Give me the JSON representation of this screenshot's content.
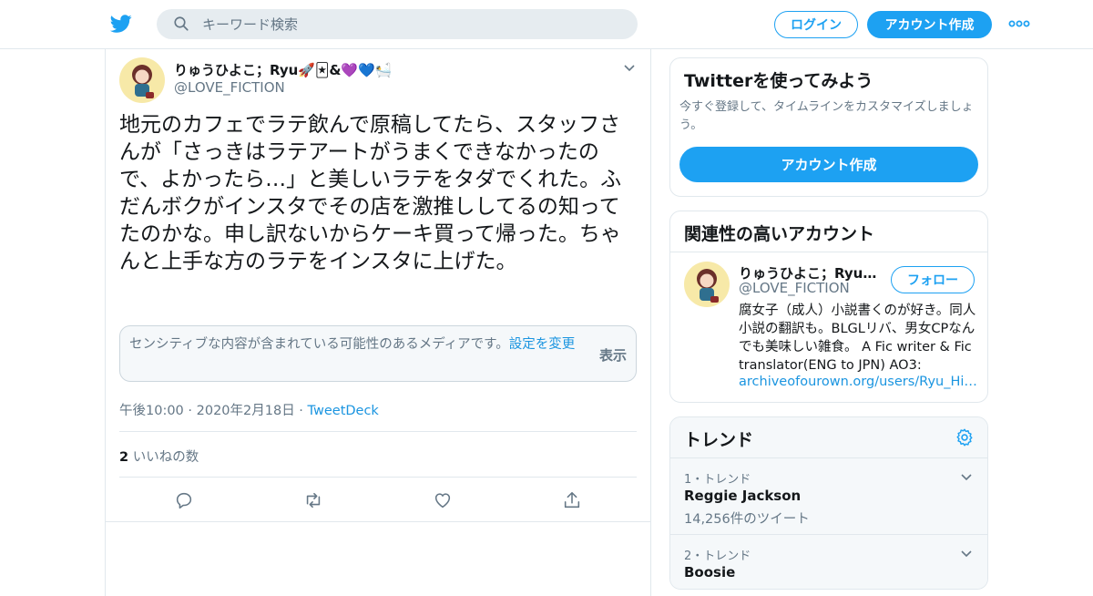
{
  "header": {
    "search_placeholder": "キーワード検索",
    "login_label": "ログイン",
    "signup_label": "アカウント作成"
  },
  "tweet": {
    "display_name": "りゅうひよこ；Ryu🚀🃏&💜💙🛀",
    "handle": "@LOVE_FICTION",
    "text": "地元のカフェでラテ飲んで原稿してたら、スタッフさんが「さっきはラテアートがうまくできなかったので、よかったら…」と美しいラテをタダでくれた。ふだんボクがインスタでその店を激推ししてるの知ってたのかな。申し訳ないからケーキ買って帰った。ちゃんと上手な方のラテをインスタに上げた。",
    "sensitive_text": "センシティブな内容が含まれている可能性のあるメディアです。",
    "sensitive_link": "設定を変更",
    "sensitive_show": "表示",
    "timestamp": "午後10:00 · 2020年2月18日 · ",
    "source": "TweetDeck",
    "likes_count": "2",
    "likes_label": " いいねの数"
  },
  "signup_card": {
    "title": "Twitterを使ってみよう",
    "description": "今すぐ登録して、タイムラインをカスタマイズしましょう。",
    "button_label": "アカウント作成"
  },
  "related": {
    "title": "関連性の高いアカウント",
    "display_name": "りゅうひよこ；Ryu🚀🃏&💜💙🛀",
    "handle": "@LOVE_FICTION",
    "follow_label": "フォロー",
    "bio": "腐女子（成人）小説書くのが好き。同人小説の翻訳も。BLGLリバ、男女CPなんでも美味しい雑食。 A Fic writer & Fic translator(ENG to JPN) AO3:",
    "url": "archiveofourown.org/users/Ryu_Hiyoko"
  },
  "trends": {
    "title": "トレンド",
    "items": [
      {
        "meta": "1・トレンド",
        "name": "Reggie Jackson",
        "count": "14,256件のツイート"
      },
      {
        "meta": "2・トレンド",
        "name": "Boosie",
        "count": ""
      }
    ]
  },
  "colors": {
    "accent": "#1da1f2",
    "link": "#1b95e0",
    "muted_text": "#657786",
    "border": "#e1e8ed",
    "panel_bg": "#f5f8fa"
  },
  "icons": [
    "twitter-bird-icon",
    "search-icon",
    "more-dots-icon",
    "chevron-down-icon",
    "reply-icon",
    "retweet-icon",
    "like-icon",
    "share-icon",
    "gear-icon"
  ]
}
